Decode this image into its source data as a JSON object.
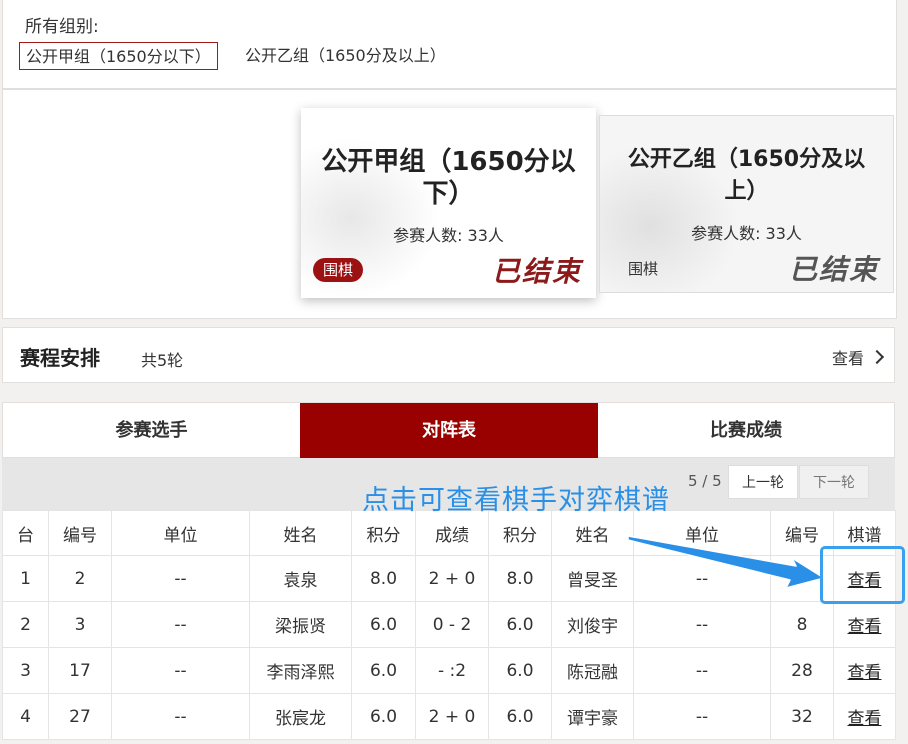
{
  "groups": {
    "title": "所有组别:",
    "tabs": [
      {
        "label": "公开甲组（1650分以下）",
        "selected": true
      },
      {
        "label": "公开乙组（1650分及以上）",
        "selected": false
      }
    ]
  },
  "cards": [
    {
      "title": "公开甲组（1650分以下）",
      "count": "参赛人数: 33人",
      "tag": "围棋",
      "status": "已结束",
      "active": true
    },
    {
      "title": "公开乙组（1650分及以上）",
      "count": "参赛人数: 33人",
      "tag": "围棋",
      "status": "已结束",
      "active": false
    }
  ],
  "schedule": {
    "title": "赛程安排",
    "rounds": "共5轮",
    "view_label": "查看"
  },
  "tabs": [
    {
      "label": "参赛选手",
      "active": false
    },
    {
      "label": "对阵表",
      "active": true
    },
    {
      "label": "比赛成绩",
      "active": false
    }
  ],
  "round": {
    "indicator": "5 / 5",
    "prev_label": "上一轮",
    "next_label": "下一轮"
  },
  "table": {
    "headers": [
      "台",
      "编号",
      "单位",
      "姓名",
      "积分",
      "成绩",
      "积分",
      "姓名",
      "单位",
      "编号",
      "棋谱"
    ],
    "rows": [
      [
        "1",
        "2",
        "--",
        "袁泉",
        "8.0",
        "2 + 0",
        "8.0",
        "曾旻圣",
        "--",
        "",
        "查看"
      ],
      [
        "2",
        "3",
        "--",
        "梁振贤",
        "6.0",
        "0 - 2",
        "6.0",
        "刘俊宇",
        "--",
        "8",
        "查看"
      ],
      [
        "3",
        "17",
        "--",
        "李雨泽熙",
        "6.0",
        "- :2",
        "6.0",
        "陈冠融",
        "--",
        "28",
        "查看"
      ],
      [
        "4",
        "27",
        "--",
        "张宸龙",
        "6.0",
        "2 + 0",
        "6.0",
        "谭宇豪",
        "--",
        "32",
        "查看"
      ]
    ]
  },
  "annotation": {
    "text": "点击可查看棋手对弈棋谱",
    "color": "#2a8fe6"
  },
  "colors": {
    "accent": "#990000",
    "tag_red": "#9c1212",
    "annotation_blue": "#3aa0ee"
  }
}
